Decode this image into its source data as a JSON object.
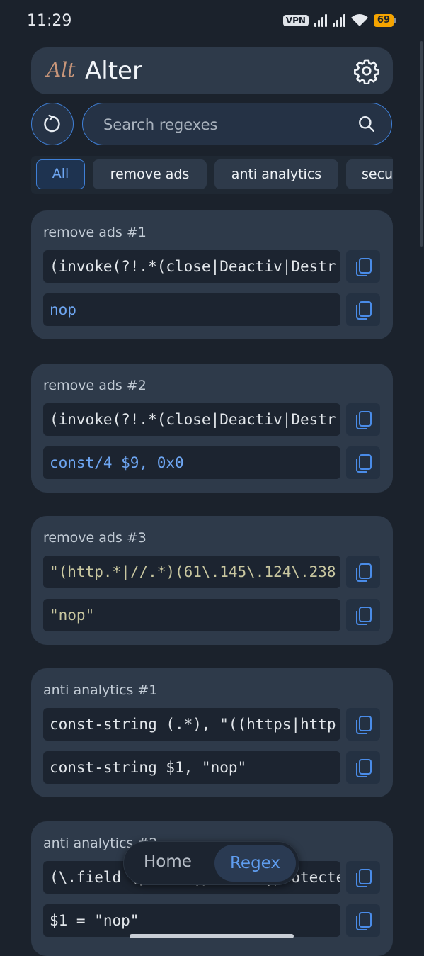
{
  "status_bar": {
    "time": "11:29",
    "vpn": "VPN",
    "battery": "69"
  },
  "header": {
    "logo": "Alt",
    "title": "Alter",
    "settings_icon": "gear-icon"
  },
  "search": {
    "placeholder": "Search regexes",
    "refresh_icon": "refresh-icon",
    "search_icon": "search-icon"
  },
  "chips": [
    "All",
    "remove ads",
    "anti analytics",
    "secu"
  ],
  "cards": [
    {
      "title": "remove ads #1",
      "pattern": "(invoke(?!.*(close|Deactiv|Destr",
      "replacement": "nop"
    },
    {
      "title": "remove ads #2",
      "pattern": "(invoke(?!.*(close|Deactiv|Destr",
      "replacement": "const/4 $9, 0x0"
    },
    {
      "title": "remove ads #3",
      "pattern": "\"(http.*|//.*)(61\\.145\\.124\\.238",
      "replacement": "\"nop\""
    },
    {
      "title": "anti analytics #1",
      "pattern": "const-string (.*), \"((https|http",
      "replacement": "const-string $1, \"nop\""
    },
    {
      "title": "anti analytics #2",
      "pattern": "(\\.field (public|private|protected) stati",
      "replacement": "$1 = \"nop\""
    }
  ],
  "bottom_nav": {
    "home": "Home",
    "regex": "Regex"
  },
  "colors": {
    "accent": "#3f7fd6",
    "card": "#2e3a4a",
    "background": "#1b222c",
    "logo": "#c9967a",
    "battery": "#f5a400"
  }
}
